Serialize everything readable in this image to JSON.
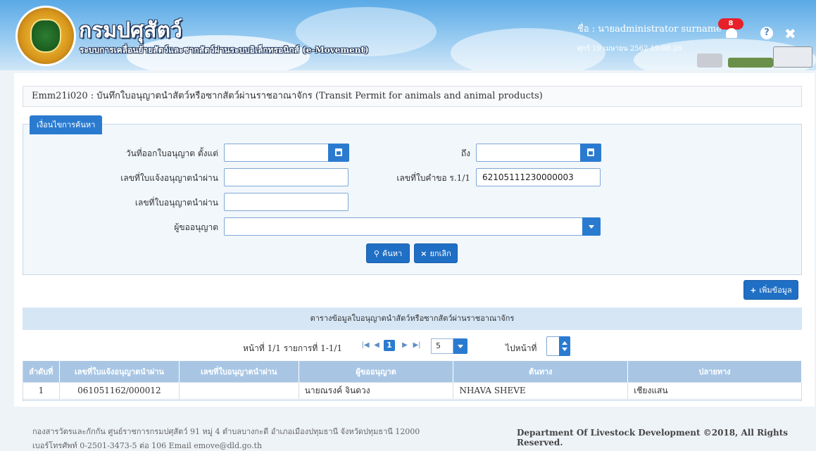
{
  "header": {
    "dept_title": "กรมปศุสัตว์",
    "system_name": "ระบบการเคลื่อนย้ายสัตว์และซากสัตว์ผ่านระบบอิเล็กทรอนิกส์ (e-Movement)",
    "user_label": "ชื่อ : นายadministrator surname",
    "datetime": "ศุกร์ 19 เมษายน 2562 19:08:26",
    "notification_count": "8",
    "help_glyph": "?",
    "close_glyph": "✖"
  },
  "page": {
    "title": "Emm21i020 : บันทึกใบอนุญาตนำสัตว์หรือซากสัตว์ผ่านราชอาณาจักร (Transit Permit for animals and animal products)"
  },
  "search": {
    "tab_label": "เงื่อนไขการค้นหา",
    "issue_date_from_label": "วันที่ออกใบอนุญาต ตั้งแต่",
    "issue_date_from_value": "",
    "issue_date_to_label": "ถึง",
    "issue_date_to_value": "",
    "notice_no_label": "เลขที่ใบแจ้งอนุญาตนำผ่าน",
    "notice_no_value": "",
    "request_no_label": "เลขที่ใบคำขอ ร.1/1",
    "request_no_value": "62105111230000003",
    "permit_no_label": "เลขที่ใบอนุญาตนำผ่าน",
    "permit_no_value": "",
    "requester_label": "ผู้ขออนุญาต",
    "requester_value": "",
    "search_button": "ค้นหา",
    "cancel_button": "ยกเลิก"
  },
  "add_button": "เพิ่มข้อมูล",
  "table": {
    "caption": "ตารางข้อมูลใบอนุญาตนำสัตว์หรือซากสัตว์ผ่านราชอาณาจักร",
    "pager": {
      "summary": "หน้าที่ 1/1 รายการที่ 1-1/1",
      "current_page": "1",
      "page_size": "5",
      "goto_label": "ไปหน้าที่",
      "goto_value": ""
    },
    "columns": [
      "ลำดับที่",
      "เลขที่ใบแจ้งอนุญาตนำผ่าน",
      "เลขที่ใบอนุญาตนำผ่าน",
      "ผู้ขออนุญาต",
      "ต้นทาง",
      "ปลายทาง"
    ],
    "rows": [
      [
        "1",
        "061051162/000012",
        "",
        "นายณรงค์ จินดวง",
        "NHAVA SHEVE",
        "เชียงแสน"
      ]
    ]
  },
  "footer": {
    "address": "กองสารวัตรและกักกัน ศูนย์ราชการกรมปศุสัตว์ 91 หมู่ 4 ตำบลบางกะดี อำเภอเมืองปทุมธานี จังหวัดปทุมธานี 12000",
    "contact": "เบอร์โทรศัพท์ 0-2501-3473-5 ต่อ 106 Email emove@dld.go.th",
    "copyright": "Department Of Livestock Development ©2018, All Rights Reserved."
  },
  "colors": {
    "primary": "#2a7bd0",
    "table_header": "#a8c6e4",
    "caption_bg": "#d6e6f5"
  }
}
